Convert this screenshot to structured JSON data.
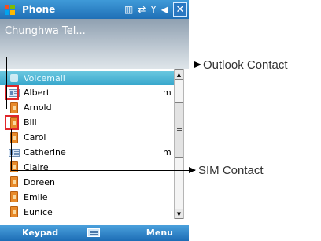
{
  "titlebar": {
    "app_title": "Phone",
    "start_icon": "windows-flag-icon",
    "close_label": "✕"
  },
  "header": {
    "operator": "Chunghwa Tel..."
  },
  "list": {
    "items": [
      {
        "label": "Voicemail",
        "type": "voicemail",
        "flag": "",
        "selected": true
      },
      {
        "label": "Albert",
        "type": "outlook",
        "flag": "m",
        "selected": false
      },
      {
        "label": "Arnold",
        "type": "sim",
        "flag": "",
        "selected": false
      },
      {
        "label": "Bill",
        "type": "sim",
        "flag": "",
        "selected": false
      },
      {
        "label": "Carol",
        "type": "sim",
        "flag": "",
        "selected": false
      },
      {
        "label": "Catherine",
        "type": "outlook",
        "flag": "m",
        "selected": false
      },
      {
        "label": "Claire",
        "type": "sim",
        "flag": "",
        "selected": false
      },
      {
        "label": "Doreen",
        "type": "sim",
        "flag": "",
        "selected": false
      },
      {
        "label": "Emile",
        "type": "sim",
        "flag": "",
        "selected": false
      },
      {
        "label": "Eunice",
        "type": "sim",
        "flag": "",
        "selected": false
      }
    ]
  },
  "softkeys": {
    "left": "Keypad",
    "right": "Menu"
  },
  "annotations": {
    "outlook": "Outlook Contact",
    "sim": "SIM Contact"
  },
  "colors": {
    "titlebar": "#2a7fc7",
    "selection": "#4db6d6",
    "highlight": "#e0262a"
  }
}
